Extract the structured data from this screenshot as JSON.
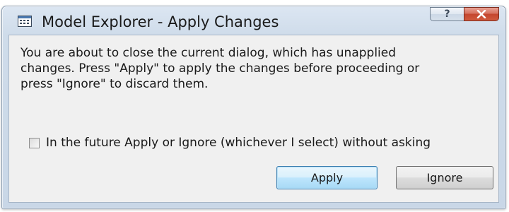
{
  "window": {
    "title": "Model Explorer - Apply Changes",
    "app_icon": "dialog-window-icon"
  },
  "caption_buttons": {
    "help_label": "?",
    "close_icon": "close-icon"
  },
  "message": {
    "line1": "You are about to close the current dialog, which has unapplied",
    "line2": "changes. Press \"Apply\" to apply the changes before proceeding or",
    "line3": "press \"Ignore\" to discard them."
  },
  "remember_choice": {
    "label": "In the future Apply or Ignore (whichever I select) without asking",
    "checked": false
  },
  "buttons": {
    "apply_label": "Apply",
    "ignore_label": "Ignore"
  },
  "colors": {
    "close_button": "#c4462e",
    "default_button_border": "#3c7fb1"
  }
}
